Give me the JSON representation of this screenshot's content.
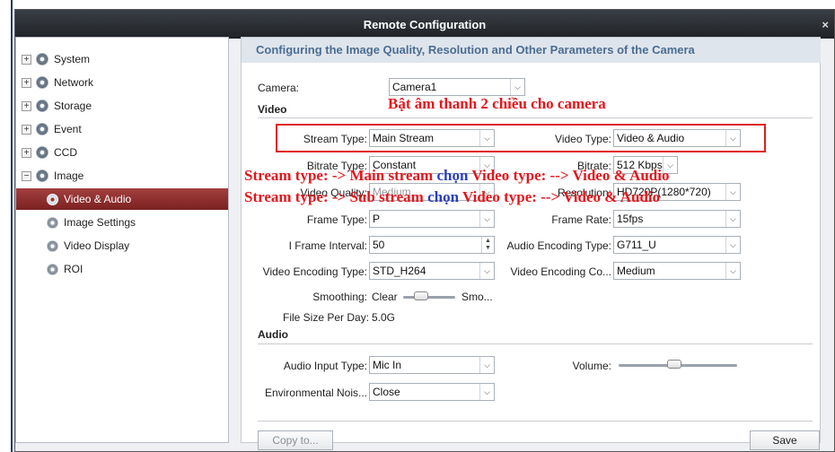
{
  "window": {
    "title": "Remote Configuration",
    "close_glyph": "×"
  },
  "tree": {
    "items": [
      {
        "label": "System",
        "expander": "+"
      },
      {
        "label": "Network",
        "expander": "+"
      },
      {
        "label": "Storage",
        "expander": "+"
      },
      {
        "label": "Event",
        "expander": "+"
      },
      {
        "label": "CCD",
        "expander": "+"
      },
      {
        "label": "Image",
        "expander": "−"
      }
    ],
    "children": [
      {
        "label": "Video & Audio",
        "selected": true
      },
      {
        "label": "Image Settings"
      },
      {
        "label": "Video Display"
      },
      {
        "label": "ROI"
      }
    ]
  },
  "main": {
    "heading": "Configuring the Image Quality, Resolution and Other Parameters of the Camera",
    "camera_label": "Camera:",
    "camera_value": "Camera1",
    "video_section": "Video",
    "audio_section": "Audio",
    "fields": {
      "stream_type_label": "Stream Type:",
      "stream_type_value": "Main Stream",
      "video_type_label": "Video Type:",
      "video_type_value": "Video & Audio",
      "bitrate_type_label": "Bitrate Type:",
      "bitrate_type_value": "Constant",
      "bitrate_label": "Bitrate:",
      "bitrate_value": "512 Kbps",
      "video_quality_label": "Video Quality:",
      "video_quality_value": "Medium",
      "resolution_label": "Resolution:",
      "resolution_value": "HD720P(1280*720)",
      "frame_type_label": "Frame Type:",
      "frame_type_value": "P",
      "frame_rate_label": "Frame Rate:",
      "frame_rate_value": "15fps",
      "i_frame_label": "I Frame Interval:",
      "i_frame_value": "50",
      "audio_enc_label": "Audio Encoding Type:",
      "audio_enc_value": "G711_U",
      "video_enc_label": "Video Encoding Type:",
      "video_enc_value": "STD_H264",
      "video_enc_co_label": "Video Encoding Co...",
      "video_enc_co_value": "Medium",
      "smoothing_label": "Smoothing:",
      "smoothing_left": "Clear",
      "smoothing_right": "Smo...",
      "file_size_label": "File Size Per Day:",
      "file_size_value": "5.0G",
      "audio_input_label": "Audio Input Type:",
      "audio_input_value": "Mic In",
      "volume_label": "Volume:",
      "env_noise_label": "Environmental Nois...",
      "env_noise_value": "Close"
    },
    "smoothing_level": 0.35,
    "volume_level": 0.47,
    "buttons": {
      "copy": "Copy to...",
      "save": "Save"
    }
  },
  "annotations": {
    "title_vi": "Bật âm thanh 2 chiều cho camera",
    "line1_red": "Stream type: -> Main stream ",
    "line1_blue": "chọn ",
    "line1_red2": "Video type: --> Video & Audio",
    "line2_red": "Stream type: -> Sub stream ",
    "line2_blue": "chọn ",
    "line2_red2": "Video type: --> Video & Audio"
  },
  "colors": {
    "annotation_red": "#e4161c",
    "annotation_blue": "#2a3fbf",
    "selection": "#8b2a2a",
    "heading_blue": "#4b6d92"
  }
}
